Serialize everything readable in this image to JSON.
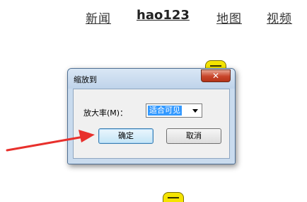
{
  "nav": {
    "news": "新闻",
    "hao123": "hao123",
    "map": "地图",
    "video": "视频"
  },
  "dialog": {
    "title": "缩放到",
    "zoom_label": "放大率(M)：",
    "zoom_value": "适合可见",
    "ok_label": "确定",
    "cancel_label": "取消",
    "close_glyph": "✕"
  },
  "colors": {
    "badge": "#f5e400",
    "arrow": "#e8302c",
    "close": "#c8452a"
  },
  "icons": {
    "badge": "minus-icon",
    "close": "close-icon",
    "dropdown": "chevron-down-icon",
    "annotation": "arrow-icon"
  }
}
